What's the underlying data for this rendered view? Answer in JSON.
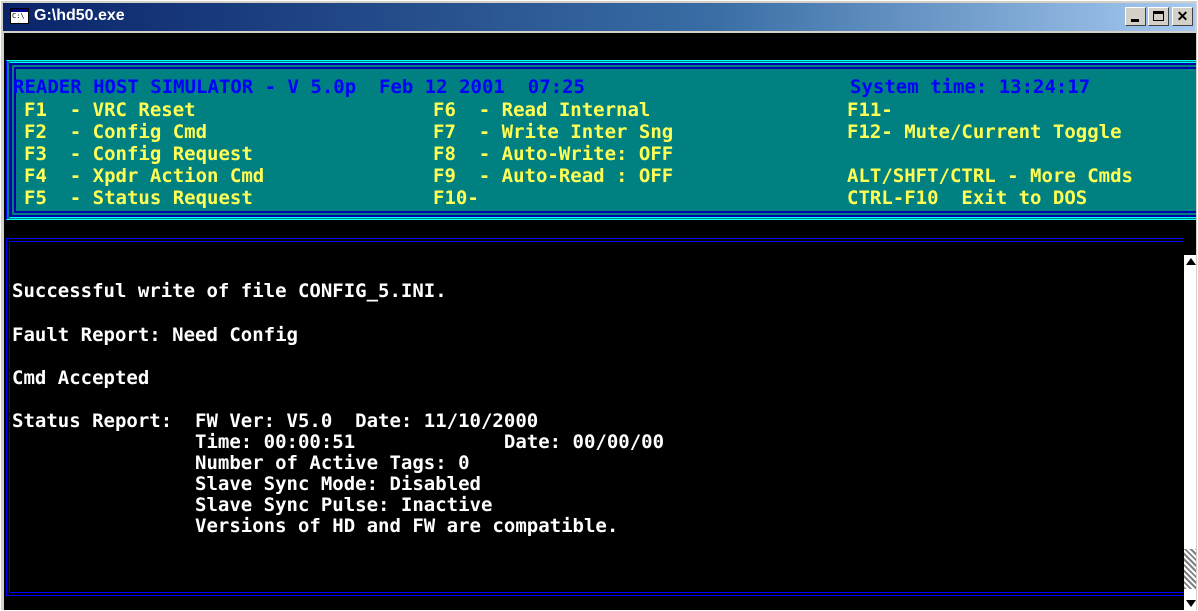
{
  "window": {
    "title": "G:\\hd50.exe",
    "icon": "console-app-icon",
    "controls": {
      "minimize": "minimize-icon",
      "maximize": "maximize-icon",
      "close": "✕"
    }
  },
  "menu": {
    "header": "READER HOST SIMULATOR - V 5.0p  Feb 12 2001  07:25",
    "system_time": "System time: 13:24:17",
    "col1": [
      "F1  - VRC Reset",
      "F2  - Config Cmd",
      "F3  - Config Request",
      "F4  - Xpdr Action Cmd",
      "F5  - Status Request"
    ],
    "col2": [
      "F6  - Read Internal",
      "F7  - Write Inter Sng",
      "F8  - Auto-Write: OFF",
      "F9  - Auto-Read : OFF",
      "F10-"
    ],
    "col3": [
      "F11-",
      "F12- Mute/Current Toggle",
      "",
      "ALT/SHFT/CTRL - More Cmds",
      "CTRL-F10  Exit to DOS"
    ]
  },
  "output": {
    "lines": [
      "Successful write of file CONFIG_5.INI.",
      "Fault Report: Need Config",
      "Cmd Accepted",
      "Status Report:  FW Ver: V5.0  Date: 11/10/2000",
      "                Time: 00:00:51             Date: 00/00/00",
      "                Number of Active Tags: 0",
      "                Slave Sync Mode: Disabled",
      "                Slave Sync Pulse: Inactive",
      "                Versions of HD and FW are compatible."
    ]
  },
  "colors": {
    "title_bar": "#0a246a",
    "menu_bg": "#008080",
    "menu_header": "#0000ff",
    "menu_keys": "#ffff55",
    "console_bg": "#000000",
    "console_text": "#ffffff"
  }
}
